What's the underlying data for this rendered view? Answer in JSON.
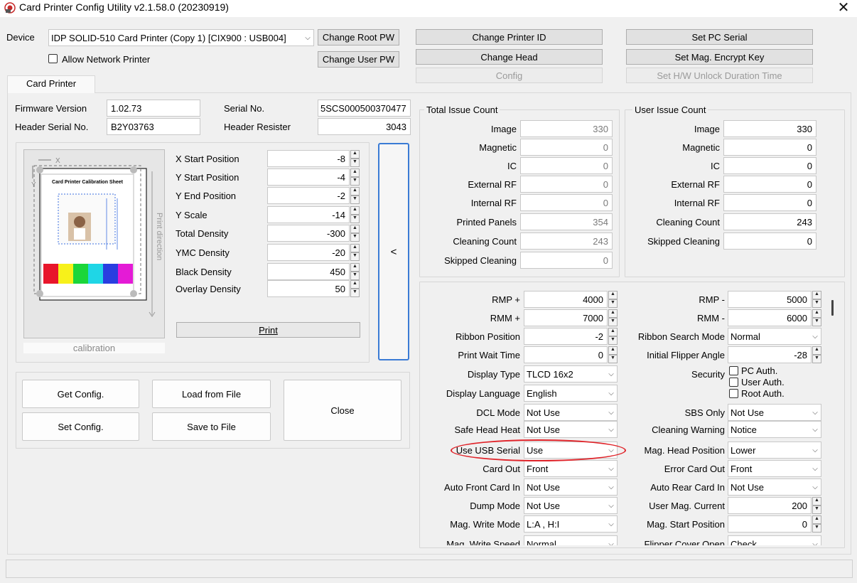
{
  "window": {
    "title": "Card Printer Config Utility v2.1.58.0 (20230919)",
    "close_glyph": "✕"
  },
  "top": {
    "device_label": "Device",
    "device_value": "IDP SOLID-510 Card Printer (Copy 1)  [CIX900 : USB004]",
    "allow_network_label": "Allow Network Printer",
    "change_root_pw": "Change Root PW",
    "change_user_pw": "Change User PW",
    "change_printer_id": "Change Printer ID",
    "change_head": "Change Head",
    "config": "Config",
    "set_pc_serial": "Set PC Serial",
    "set_mag_key": "Set Mag. Encrypt Key",
    "set_hw_unlock": "Set H/W Unlock Duration Time"
  },
  "tab": {
    "label": "Card Printer"
  },
  "info": {
    "firmware_label": "Firmware Version",
    "firmware_value": "1.02.73",
    "serial_label": "Serial No.",
    "serial_value": "5SCS000500370477",
    "header_serial_label": "Header Serial No.",
    "header_serial_value": "B2Y03763",
    "header_resister_label": "Header Resister",
    "header_resister_value": "3043"
  },
  "calibration": {
    "image_caption": "calibration",
    "sheet_title": "Card Printer Calibration Sheet",
    "axis_x": "X",
    "axis_y": "Y",
    "print_direction": "Print direction",
    "swatches": [
      "#e8162b",
      "#f7f11a",
      "#1bd63a",
      "#1fd6e6",
      "#2a3ee0",
      "#e41bd6"
    ],
    "params": [
      {
        "label": "X Start Position",
        "value": "-8"
      },
      {
        "label": "Y Start Position",
        "value": "-4"
      },
      {
        "label": "Y End Position",
        "value": "-2"
      },
      {
        "label": "Y Scale",
        "value": "-14"
      },
      {
        "label": "Total Density",
        "value": "-300"
      },
      {
        "label": "YMC Density",
        "value": "-20"
      },
      {
        "label": "Black Density",
        "value": "450"
      },
      {
        "label": "Overlay Density",
        "value": "50"
      }
    ],
    "print_button": "Print",
    "collapse_glyph": "<"
  },
  "actions": {
    "get_config": "Get Config.",
    "load_from_file": "Load from File",
    "set_config": "Set Config.",
    "save_to_file": "Save to File",
    "close": "Close"
  },
  "total_issue": {
    "title": "Total Issue Count",
    "rows": [
      {
        "label": "Image",
        "value": "330"
      },
      {
        "label": "Magnetic",
        "value": "0"
      },
      {
        "label": "IC",
        "value": "0"
      },
      {
        "label": "External RF",
        "value": "0"
      },
      {
        "label": "Internal RF",
        "value": "0"
      },
      {
        "label": "Printed Panels",
        "value": "354"
      },
      {
        "label": "Cleaning Count",
        "value": "243"
      },
      {
        "label": "Skipped Cleaning",
        "value": "0"
      }
    ]
  },
  "user_issue": {
    "title": "User Issue Count",
    "rows": [
      {
        "label": "Image",
        "value": "330"
      },
      {
        "label": "Magnetic",
        "value": "0"
      },
      {
        "label": "IC",
        "value": "0"
      },
      {
        "label": "External RF",
        "value": "0"
      },
      {
        "label": "Internal RF",
        "value": "0"
      },
      {
        "label": "Cleaning Count",
        "value": "243"
      },
      {
        "label": "Skipped Cleaning",
        "value": "0"
      }
    ]
  },
  "settings": {
    "left": [
      {
        "label": "RMP +",
        "value": "4000"
      },
      {
        "label": "RMM +",
        "value": "7000"
      },
      {
        "label": "Ribbon Position",
        "value": "-2"
      },
      {
        "label": "Print Wait Time",
        "value": "0"
      },
      {
        "label": "Display Type",
        "value": "TLCD 16x2"
      },
      {
        "label": "Display Language",
        "value": "English"
      },
      {
        "label": "DCL Mode",
        "value": "Not Use"
      },
      {
        "label": "Safe Head Heat",
        "value": "Not Use"
      },
      {
        "label": "Use USB Serial",
        "value": "Use"
      },
      {
        "label": "Card Out",
        "value": "Front"
      },
      {
        "label": "Auto Front Card In",
        "value": "Not Use"
      },
      {
        "label": "Dump Mode",
        "value": "Not Use"
      },
      {
        "label": "Mag. Write Mode",
        "value": "L:A , H:I"
      },
      {
        "label": "Mag. Write Speed",
        "value": "Normal"
      }
    ],
    "right": [
      {
        "label": "RMP -",
        "value": "5000"
      },
      {
        "label": "RMM -",
        "value": "6000"
      },
      {
        "label": "Ribbon Search Mode",
        "value": "Normal"
      },
      {
        "label": "Initial Flipper Angle",
        "value": "-28"
      },
      {
        "label": "SBS Only",
        "value": "Not Use"
      },
      {
        "label": "Cleaning Warning",
        "value": "Notice"
      },
      {
        "label": "Mag. Head Position",
        "value": "Lower"
      },
      {
        "label": "Error Card Out",
        "value": "Front"
      },
      {
        "label": "Auto Rear Card In",
        "value": "Not Use"
      },
      {
        "label": "User Mag. Current",
        "value": "200"
      },
      {
        "label": "Mag. Start Position",
        "value": "0"
      },
      {
        "label": "Flipper Cover Open",
        "value": "Check"
      }
    ],
    "security": {
      "label": "Security",
      "options": [
        "PC Auth.",
        "User Auth.",
        "Root Auth."
      ]
    }
  },
  "colors": {
    "highlight_oval": "#e0242a"
  }
}
